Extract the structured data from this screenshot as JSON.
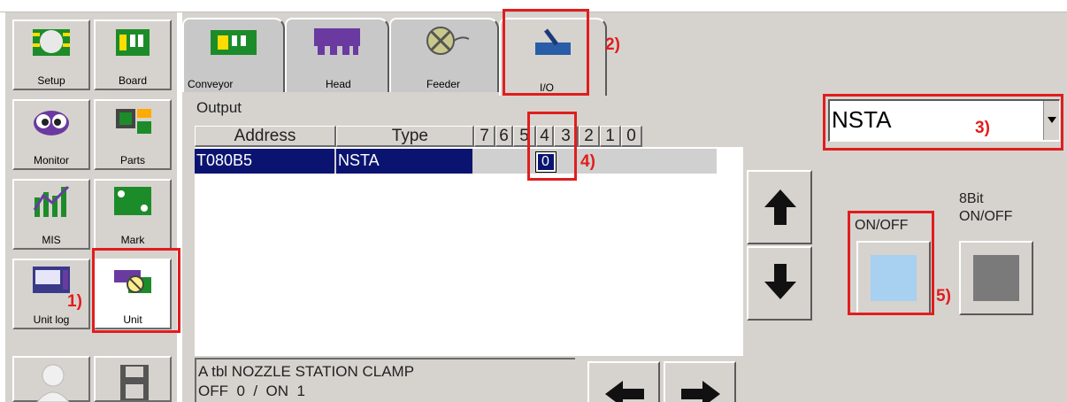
{
  "sidebar": {
    "items": [
      {
        "label": "Setup",
        "icon": "setup-chip-icon"
      },
      {
        "label": "Board",
        "icon": "board-icon"
      },
      {
        "label": "Monitor",
        "icon": "monitor-eyes-icon"
      },
      {
        "label": "Parts",
        "icon": "parts-chip-icon"
      },
      {
        "label": "MIS",
        "icon": "mis-chart-icon"
      },
      {
        "label": "Mark",
        "icon": "mark-board-icon"
      },
      {
        "label": "Unit log",
        "icon": "unit-log-icon"
      },
      {
        "label": "Unit",
        "icon": "unit-icon"
      }
    ],
    "bottom_icons": [
      "user-icon",
      "save-disk-icon"
    ]
  },
  "tabs": [
    {
      "label": "Conveyor"
    },
    {
      "label": "Head"
    },
    {
      "label": "Feeder"
    },
    {
      "label": "I/O"
    }
  ],
  "output": {
    "title": "Output",
    "columns": {
      "address": "Address",
      "type": "Type",
      "bits": [
        "7",
        "6",
        "5",
        "4",
        "3",
        "2",
        "1",
        "0"
      ]
    },
    "rows": [
      {
        "address": "T080B5",
        "type": "NSTA",
        "bit5": "0"
      }
    ]
  },
  "dropdown": {
    "value": "NSTA"
  },
  "buttons": {
    "on_off_label": "ON/OFF",
    "eight_bit_label_line1": "8Bit",
    "eight_bit_label_line2": "ON/OFF"
  },
  "description": {
    "line1": "A tbl NOZZLE STATION CLAMP",
    "line2": "OFF  0  /  ON  1"
  },
  "annotations": [
    "1)",
    "2)",
    "3)",
    "4)",
    "5)"
  ],
  "colors": {
    "selected_row": "#0a1470",
    "panel": "#d6d3ce",
    "annotation": "#e11d1d",
    "on_off_fill": "#a8d0f0",
    "eight_bit_fill": "#7a7a7a"
  }
}
